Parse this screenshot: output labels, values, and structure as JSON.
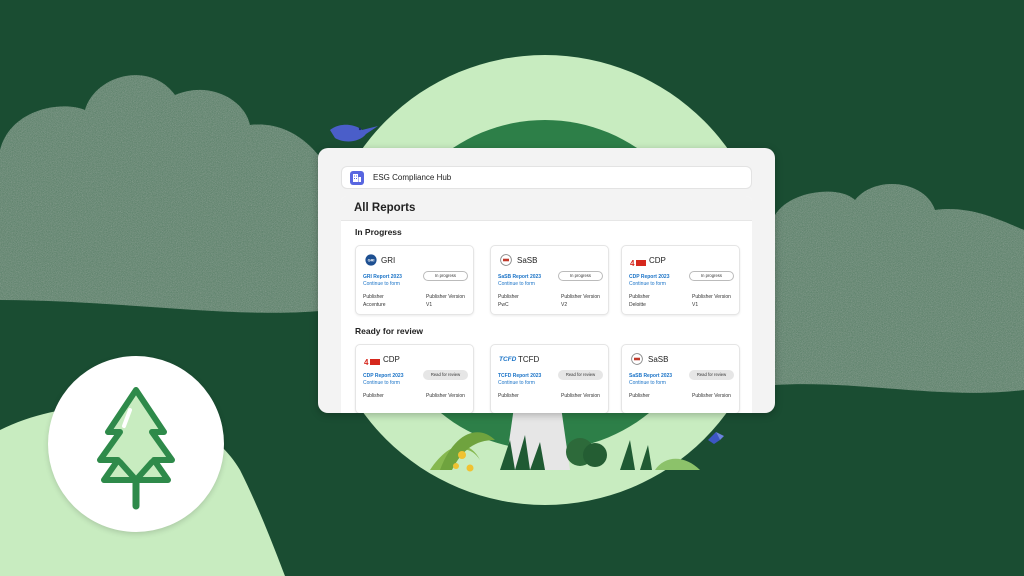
{
  "app": {
    "title": "ESG Compliance Hub"
  },
  "panel": {
    "title": "All Reports"
  },
  "sections": [
    {
      "title": "In Progress",
      "cards": [
        {
          "logo": "GRI",
          "name": "GRI",
          "report": "GRI Report 2023",
          "link": "Continue to form",
          "status": "In progress",
          "k1": "Publisher",
          "k2": "Publisher Version",
          "v1": "Accenture",
          "v2": "V1"
        },
        {
          "logo": "SASB",
          "name": "SaSB",
          "report": "SaSB Report 2023",
          "link": "Continue to form",
          "status": "In progress",
          "k1": "Publisher",
          "k2": "Publisher Version",
          "v1": "PwC",
          "v2": "V2"
        },
        {
          "logo": "CDP",
          "name": "CDP",
          "report": "CDP Report 2023",
          "link": "Continue to form",
          "status": "In progress",
          "k1": "Publisher",
          "k2": "Publisher Version",
          "v1": "Deloitte",
          "v2": "V1"
        }
      ]
    },
    {
      "title": "Ready for review",
      "cards": [
        {
          "logo": "CDP",
          "name": "CDP",
          "report": "CDP Report 2023",
          "link": "Continue to form",
          "status": "Read for review",
          "k1": "Publisher",
          "k2": "Publisher Version",
          "v1": "",
          "v2": ""
        },
        {
          "logo": "TCFD",
          "name": "TCFD",
          "report": "TCFD Report 2023",
          "link": "Continue to form",
          "status": "Read for review",
          "k1": "Publisher",
          "k2": "Publisher Version",
          "v1": "",
          "v2": ""
        },
        {
          "logo": "SASB",
          "name": "SaSB",
          "report": "SaSB Report 2023",
          "link": "Continue to form",
          "status": "Read for review",
          "k1": "Publisher",
          "k2": "Publisher Version",
          "v1": "",
          "v2": ""
        }
      ]
    }
  ],
  "icons": {
    "app": "building-icon",
    "tree": "pine-tree-icon",
    "bird": "bird-icon",
    "butterfly": "butterfly-icon"
  },
  "colors": {
    "background": "#1a4d32",
    "light_green": "#c8ecc0",
    "accent_blue": "#1a73c7",
    "app_icon": "#5866e0",
    "tree_icon": "#2e8a4a"
  }
}
